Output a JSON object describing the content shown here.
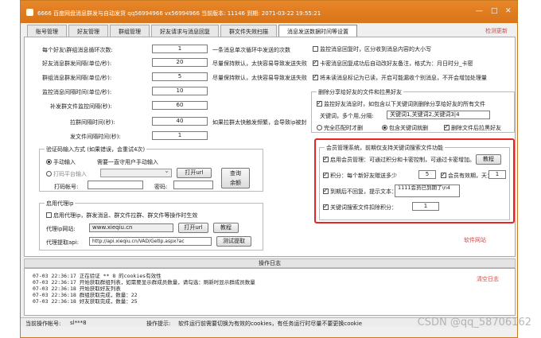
{
  "window": {
    "title": "6666  百度网盘消息群发与自动发货    qq56994966    vx56994966     当前版本: 11146   到期: 2071-03-22 19:55:21",
    "controls": [
      "—",
      "□",
      "✕"
    ]
  },
  "tabs": [
    "账号管理",
    "好友管理",
    "群组管理",
    "好友请求与消息回复",
    "群文件失效扫描",
    "消息发送数据时间等设置"
  ],
  "refresh_link": "检测更新",
  "left": {
    "rows": [
      {
        "label": "每个好友\\群组消息循环次数:",
        "value": "1",
        "note": "一条消息单次循环中发送的次数"
      },
      {
        "label": "好友消息群发间隔(单位/秒):",
        "value": "20",
        "note": "尽量保持默认，太快容易导致发送失败"
      },
      {
        "label": "群组消息群发间隔(单位/秒):",
        "value": "5",
        "note": "尽量保持默认，太快容易导致发送失败"
      },
      {
        "label": "监控消息间隔时间(单位/秒):",
        "value": "10",
        "note": ""
      },
      {
        "label": "补发群文件监控间隔(秒):",
        "value": "60",
        "note": ""
      },
      {
        "label": "拉群间隔时间(秒):",
        "value": "40",
        "note": "如果拉群太快触发频繁，会导致ip被封"
      },
      {
        "label": "发文件间隔时间(秒):",
        "value": "1",
        "note": ""
      }
    ],
    "captcha": {
      "title": "验证码输入方式   (如果错误，会重试4次)",
      "manual": "手动输入",
      "manual_note": "需要一直守用户手动输入",
      "platform": "打码平台输入",
      "open_url": "打开url",
      "query_balance_1": "查询",
      "query_balance_2": "余额",
      "account_label": "打码帐号:",
      "password_label": "密码:"
    },
    "proxy": {
      "title": "启用代理ip",
      "enable": "启用代理ip，群发消息、群文件拉群、群文件等操作时生效",
      "site_label": "代理ip网站:",
      "site_value": "www.xieqiu.cn",
      "open_url": "打开url",
      "tutorial": "教程",
      "api_label": "代理提取api:",
      "api_value": "http://api.xieqiu.cn/VAD/GetIp.aspx?ac",
      "test": "测试提取"
    }
  },
  "right": {
    "cb_monitor": "监控消息回复时，区分收到消息内容的大小写",
    "cb_card": "卡密消息回复成功后自动改好友备注，格式为：月日时分_卡密",
    "cb_unread": "将未读消息标记为已读，开启可能漏收个别消息，不开会增加处理量",
    "share_group": {
      "title": "删除分享给好友的文件和拉黑好友",
      "cb_monitor_share": "监控好友消息时，如包含以下关键词则删除分享给好友的所有文件",
      "kw_label": "关键词，多个用,分隔:",
      "kw_value": "关键词1,关键词2,关键词3|4",
      "radio_exact": "完全匹配时才删",
      "radio_contains": "包含关键词就删",
      "cb_block": "删除文件后拉黑好友"
    },
    "member_group": {
      "title": "会员管理系统，前期仅支持关键词搜索文件功能",
      "cb_enable": "启用会员管理：可通过积分和卡密控制，可通过卡密增加。",
      "tutorial": "教程",
      "cb_points": "积分：每个新好友赠送多少",
      "points_value": "5",
      "cb_expire": "会员有效期，天：",
      "expire_value": "1",
      "cb_reply": "到期后不回复，提示文本：",
      "reply_text": "1111会员已到期了\\n4",
      "cb_deduct": "关键词搜索文件扣除积分：",
      "deduct_value": "1"
    },
    "software_site": "软件网站"
  },
  "log": {
    "title": "操作日志",
    "clear": "清空日志",
    "lines": [
      "07-03 22:36:17  正在验证  **  8 的cookies有效性",
      "07-03 22:36:17  开始获取群组列表，如需要显示群成员数量，请勾选：刷新时显示群成员数量",
      "07-03 22:36:18  开始获取好友列表",
      "07-03 22:36:18  群组获取完成，数量：22",
      "07-03 22:36:18  好友获取完成，数量：25"
    ]
  },
  "status": {
    "account_label": "当前操作帐号:",
    "account_value": "sl***8",
    "tip_label": "操作提示:",
    "tip_value": "软件运行前需要切换为有效的cookies，有任务运行时尽量不要更换cookie"
  },
  "watermark": "CSDN @qq_58706162"
}
